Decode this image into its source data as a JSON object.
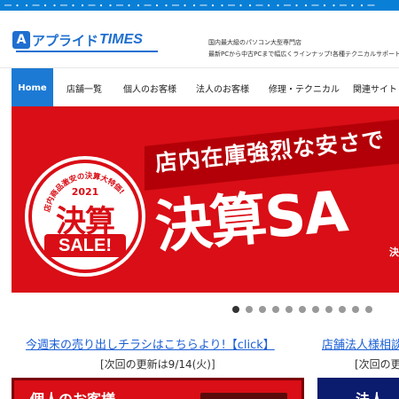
{
  "topbar": {
    "text": "ー・・ー・・ー・・ー・・ー・・ー・・ー・・ー・・ー・・ー・・ー・・ー・・ー・・ー"
  },
  "header": {
    "logo_mark": "A",
    "logo_text": "アプライド",
    "logo_en": "TIMES",
    "tagline_line1": "国内最大級のパソコン大型専門店",
    "tagline_line2": "最新PCから中古PCまで幅広くラインナップ!各種テクニカルサポート"
  },
  "nav": {
    "items": [
      {
        "label": "Home",
        "active": true
      },
      {
        "label": "店舗一覧"
      },
      {
        "label": "個人のお客様"
      },
      {
        "label": "法人のお客様"
      },
      {
        "label": "修理・テクニカル"
      },
      {
        "label": "関連サイト"
      }
    ]
  },
  "hero": {
    "headline": "店内在庫強烈な安さで",
    "big_text": "決算SA",
    "badge_arc": "店内商品激安の決算大特価!",
    "badge_year": "2021",
    "badge_main": "決算",
    "badge_sale": "SALE!",
    "corner": "決"
  },
  "slider": {
    "dot_count": 11,
    "active_index": 0
  },
  "links": {
    "flyer_label": "今週末の売り出しチラシはこちらより!【click】",
    "flyer_update": "[次回の更新は9/14(火)]",
    "corp_label": "店舗法人様相談",
    "corp_update": "[次回の更"
  },
  "cards": {
    "personal_title": "個人のお客様",
    "corporate_title": "法人"
  },
  "colors": {
    "brand_blue": "#1d7ad4",
    "sale_red": "#d90e16",
    "link_blue": "#1a5fd6",
    "corporate_navy": "#0b1b6e"
  }
}
